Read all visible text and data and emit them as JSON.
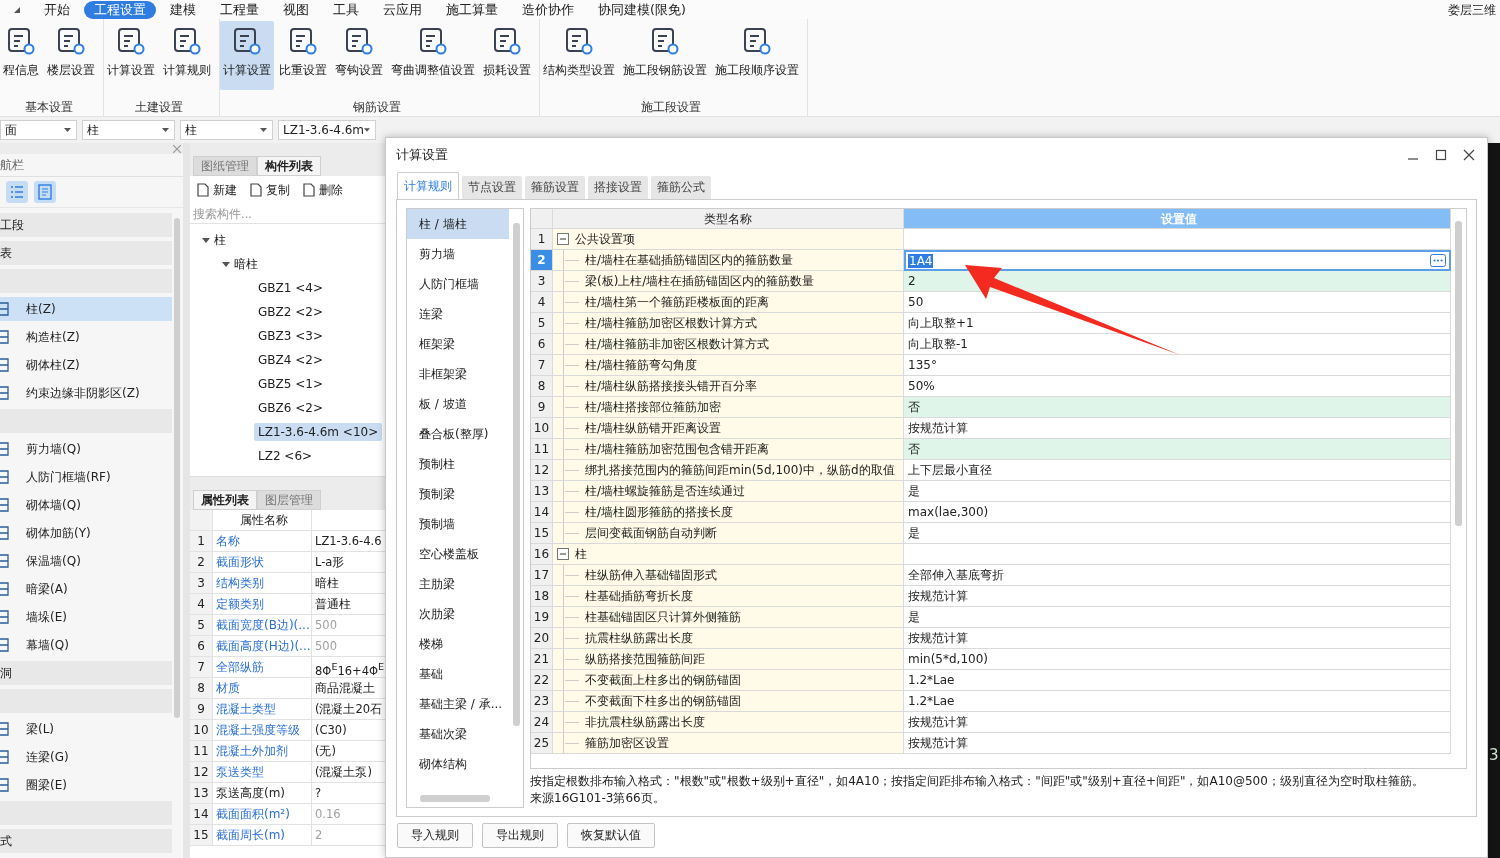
{
  "menu": {
    "tabs": [
      {
        "label": "开始",
        "selected": false
      },
      {
        "label": "工程设置",
        "selected": true
      },
      {
        "label": "建模",
        "selected": false
      },
      {
        "label": "工程量",
        "selected": false
      },
      {
        "label": "视图",
        "selected": false
      },
      {
        "label": "工具",
        "selected": false
      },
      {
        "label": "云应用",
        "selected": false
      },
      {
        "label": "施工算量",
        "selected": false
      },
      {
        "label": "造价协作",
        "selected": false
      },
      {
        "label": "协同建模(限免)",
        "selected": false
      }
    ],
    "right_label": "娄层三维"
  },
  "ribbon": {
    "groups": [
      {
        "label": "基本设置",
        "buttons": [
          {
            "label": "程信息",
            "selected": false
          },
          {
            "label": "楼层设置",
            "selected": false
          }
        ]
      },
      {
        "label": "土建设置",
        "buttons": [
          {
            "label": "计算设置",
            "selected": false
          },
          {
            "label": "计算规则",
            "selected": false
          }
        ]
      },
      {
        "label": "钢筋设置",
        "buttons": [
          {
            "label": "计算设置",
            "selected": true
          },
          {
            "label": "比重设置",
            "selected": false
          },
          {
            "label": "弯钩设置",
            "selected": false
          },
          {
            "label": "弯曲调整值设置",
            "selected": false
          },
          {
            "label": "损耗设置",
            "selected": false
          }
        ]
      },
      {
        "label": "施工段设置",
        "buttons": [
          {
            "label": "结构类型设置",
            "selected": false
          },
          {
            "label": "施工段钢筋设置",
            "selected": false
          },
          {
            "label": "施工段顺序设置",
            "selected": false
          }
        ]
      }
    ]
  },
  "selectors": [
    "面",
    "柱",
    "柱",
    "LZ1-3.6-4.6m"
  ],
  "nav": {
    "title": "航栏",
    "items": [
      {
        "kind": "band",
        "label": "工段"
      },
      {
        "kind": "band",
        "label": "表"
      },
      {
        "kind": "band"
      },
      {
        "kind": "item",
        "label": "柱(Z)",
        "selected": true
      },
      {
        "kind": "item",
        "label": "构造柱(Z)",
        "selected": false
      },
      {
        "kind": "item",
        "label": "砌体柱(Z)",
        "selected": false
      },
      {
        "kind": "item",
        "label": "约束边缘非阴影区(Z)",
        "selected": false
      },
      {
        "kind": "band"
      },
      {
        "kind": "item",
        "label": "剪力墙(Q)",
        "selected": false
      },
      {
        "kind": "item",
        "label": "人防门框墙(RF)",
        "selected": false
      },
      {
        "kind": "item",
        "label": "砌体墙(Q)",
        "selected": false
      },
      {
        "kind": "item",
        "label": "砌体加筋(Y)",
        "selected": false
      },
      {
        "kind": "item",
        "label": "保温墙(Q)",
        "selected": false
      },
      {
        "kind": "item",
        "label": "暗梁(A)",
        "selected": false
      },
      {
        "kind": "item",
        "label": "墙垛(E)",
        "selected": false
      },
      {
        "kind": "item",
        "label": "幕墙(Q)",
        "selected": false
      },
      {
        "kind": "band",
        "label": "洞"
      },
      {
        "kind": "band"
      },
      {
        "kind": "item",
        "label": "梁(L)",
        "selected": false
      },
      {
        "kind": "item",
        "label": "连梁(G)",
        "selected": false
      },
      {
        "kind": "item",
        "label": "圈梁(E)",
        "selected": false
      },
      {
        "kind": "band"
      },
      {
        "kind": "band",
        "label": "式"
      }
    ]
  },
  "components": {
    "tabs": [
      {
        "label": "图纸管理",
        "selected": false
      },
      {
        "label": "构件列表",
        "selected": true
      }
    ],
    "toolbar": [
      "新建",
      "复制",
      "删除"
    ],
    "search": {
      "placeholder": "搜索构件..."
    },
    "tree": [
      {
        "label": "柱",
        "expanded": true,
        "children": [
          {
            "label": "暗柱",
            "expanded": true,
            "children": [
              {
                "label": "GBZ1 <4>",
                "selected": false
              },
              {
                "label": "GBZ2 <2>",
                "selected": false
              },
              {
                "label": "GBZ3 <3>",
                "selected": false
              },
              {
                "label": "GBZ4 <2>",
                "selected": false
              },
              {
                "label": "GBZ5 <1>",
                "selected": false
              },
              {
                "label": "GBZ6 <2>",
                "selected": false
              },
              {
                "label": "LZ1-3.6-4.6m <10>",
                "selected": true
              },
              {
                "label": "LZ2 <6>",
                "selected": false
              }
            ]
          }
        ]
      }
    ]
  },
  "properties": {
    "tabs": [
      {
        "label": "属性列表",
        "selected": true
      },
      {
        "label": "图层管理",
        "selected": false
      }
    ],
    "column": "属性名称",
    "rows": [
      {
        "num": "1",
        "name": "名称",
        "value": "LZ1-3.6-4.6",
        "link": true,
        "greyed": false
      },
      {
        "num": "2",
        "name": "截面形状",
        "value": "L-a形",
        "link": true,
        "greyed": false
      },
      {
        "num": "3",
        "name": "结构类别",
        "value": "暗柱",
        "link": true,
        "greyed": false
      },
      {
        "num": "4",
        "name": "定额类别",
        "value": "普通柱",
        "link": true,
        "greyed": false
      },
      {
        "num": "5",
        "name": "截面宽度(B边)(...",
        "value": "500",
        "link": true,
        "greyed": true
      },
      {
        "num": "6",
        "name": "截面高度(H边)(...",
        "value": "500",
        "link": true,
        "greyed": true
      },
      {
        "num": "7",
        "name": "全部纵筋",
        "value": "8Φ$^{E}$16+4Φ$^{E}$",
        "link": true,
        "greyed": false
      },
      {
        "num": "8",
        "name": "材质",
        "value": "商品混凝土",
        "link": true,
        "greyed": false
      },
      {
        "num": "9",
        "name": "混凝土类型",
        "value": "(混凝土20石",
        "link": true,
        "greyed": false
      },
      {
        "num": "10",
        "name": "混凝土强度等级",
        "value": "(C30)",
        "link": true,
        "greyed": false
      },
      {
        "num": "11",
        "name": "混凝土外加剂",
        "value": "(无)",
        "link": true,
        "greyed": false
      },
      {
        "num": "12",
        "name": "泵送类型",
        "value": "(混凝土泵)",
        "link": true,
        "greyed": false
      },
      {
        "num": "13",
        "name": "泵送高度(m)",
        "value": "?",
        "link": false,
        "greyed": false
      },
      {
        "num": "14",
        "name": "截面面积(m²)",
        "value": "0.16",
        "link": true,
        "greyed": true
      },
      {
        "num": "15",
        "name": "截面周长(m)",
        "value": "2",
        "link": true,
        "greyed": true
      }
    ]
  },
  "dialog": {
    "title": "计算设置",
    "tabs": [
      {
        "label": "计算规则",
        "selected": true
      },
      {
        "label": "节点设置",
        "selected": false
      },
      {
        "label": "箍筋设置",
        "selected": false
      },
      {
        "label": "搭接设置",
        "selected": false
      },
      {
        "label": "箍筋公式",
        "selected": false
      }
    ],
    "categories": [
      {
        "label": "柱 / 墙柱",
        "selected": true
      },
      {
        "label": "剪力墙",
        "selected": false
      },
      {
        "label": "人防门框墙",
        "selected": false
      },
      {
        "label": "连梁",
        "selected": false
      },
      {
        "label": "框架梁",
        "selected": false
      },
      {
        "label": "非框架梁",
        "selected": false
      },
      {
        "label": "板 / 坡道",
        "selected": false
      },
      {
        "label": "叠合板(整厚)",
        "selected": false
      },
      {
        "label": "预制柱",
        "selected": false
      },
      {
        "label": "预制梁",
        "selected": false
      },
      {
        "label": "预制墙",
        "selected": false
      },
      {
        "label": "空心楼盖板",
        "selected": false
      },
      {
        "label": "主肋梁",
        "selected": false
      },
      {
        "label": "次肋梁",
        "selected": false
      },
      {
        "label": "楼梯",
        "selected": false
      },
      {
        "label": "基础",
        "selected": false
      },
      {
        "label": "基础主梁 / 承...",
        "selected": false
      },
      {
        "label": "基础次梁",
        "selected": false
      },
      {
        "label": "砌体结构",
        "selected": false
      }
    ],
    "table": {
      "columns": [
        "类型名称",
        "设置值"
      ],
      "rows": [
        {
          "kind": "group",
          "num": "1",
          "name": "公共设置项",
          "expanded": true
        },
        {
          "kind": "item",
          "num": "2",
          "name": "柱/墙柱在基础插筋锚固区内的箍筋数量",
          "value": "1A4",
          "selected": true,
          "highlighted": false
        },
        {
          "kind": "item",
          "num": "3",
          "name": "梁(板)上柱/墙柱在插筋锚固区内的箍筋数量",
          "value": "2",
          "selected": false,
          "highlighted": true
        },
        {
          "kind": "item",
          "num": "4",
          "name": "柱/墙柱第一个箍筋距楼板面的距离",
          "value": "50",
          "selected": false,
          "highlighted": false
        },
        {
          "kind": "item",
          "num": "5",
          "name": "柱/墙柱箍筋加密区根数计算方式",
          "value": "向上取整+1",
          "selected": false,
          "highlighted": false
        },
        {
          "kind": "item",
          "num": "6",
          "name": "柱/墙柱箍筋非加密区根数计算方式",
          "value": "向上取整-1",
          "selected": false,
          "highlighted": false
        },
        {
          "kind": "item",
          "num": "7",
          "name": "柱/墙柱箍筋弯勾角度",
          "value": "135°",
          "selected": false,
          "highlighted": false
        },
        {
          "kind": "item",
          "num": "8",
          "name": "柱/墙柱纵筋搭接接头错开百分率",
          "value": "50%",
          "selected": false,
          "highlighted": false
        },
        {
          "kind": "item",
          "num": "9",
          "name": "柱/墙柱搭接部位箍筋加密",
          "value": "否",
          "selected": false,
          "highlighted": true
        },
        {
          "kind": "item",
          "num": "10",
          "name": "柱/墙柱纵筋错开距离设置",
          "value": "按规范计算",
          "selected": false,
          "highlighted": false
        },
        {
          "kind": "item",
          "num": "11",
          "name": "柱/墙柱箍筋加密范围包含错开距离",
          "value": "否",
          "selected": false,
          "highlighted": true
        },
        {
          "kind": "item",
          "num": "12",
          "name": "绑扎搭接范围内的箍筋间距min(5d,100)中，纵筋d的取值",
          "value": "上下层最小直径",
          "selected": false,
          "highlighted": false
        },
        {
          "kind": "item",
          "num": "13",
          "name": "柱/墙柱螺旋箍筋是否连续通过",
          "value": "是",
          "selected": false,
          "highlighted": false
        },
        {
          "kind": "item",
          "num": "14",
          "name": "柱/墙柱圆形箍筋的搭接长度",
          "value": "max(lae,300)",
          "selected": false,
          "highlighted": false
        },
        {
          "kind": "item",
          "num": "15",
          "name": "层间变截面钢筋自动判断",
          "value": "是",
          "selected": false,
          "highlighted": false
        },
        {
          "kind": "group",
          "num": "16",
          "name": "柱",
          "expanded": true
        },
        {
          "kind": "item",
          "num": "17",
          "name": "柱纵筋伸入基础锚固形式",
          "value": "全部伸入基底弯折",
          "selected": false,
          "highlighted": false
        },
        {
          "kind": "item",
          "num": "18",
          "name": "柱基础插筋弯折长度",
          "value": "按规范计算",
          "selected": false,
          "highlighted": false
        },
        {
          "kind": "item",
          "num": "19",
          "name": "柱基础锚固区只计算外侧箍筋",
          "value": "是",
          "selected": false,
          "highlighted": false
        },
        {
          "kind": "item",
          "num": "20",
          "name": "抗震柱纵筋露出长度",
          "value": "按规范计算",
          "selected": false,
          "highlighted": false
        },
        {
          "kind": "item",
          "num": "21",
          "name": "纵筋搭接范围箍筋间距",
          "value": "min(5*d,100)",
          "selected": false,
          "highlighted": false
        },
        {
          "kind": "item",
          "num": "22",
          "name": "不变截面上柱多出的钢筋锚固",
          "value": "1.2*Lae",
          "selected": false,
          "highlighted": false
        },
        {
          "kind": "item",
          "num": "23",
          "name": "不变截面下柱多出的钢筋锚固",
          "value": "1.2*Lae",
          "selected": false,
          "highlighted": false
        },
        {
          "kind": "item",
          "num": "24",
          "name": "非抗震柱纵筋露出长度",
          "value": "按规范计算",
          "selected": false,
          "highlighted": false
        },
        {
          "kind": "item",
          "num": "25",
          "name": "箍筋加密区设置",
          "value": "按规范计算",
          "selected": false,
          "highlighted": false
        }
      ]
    },
    "note": "按指定根数排布输入格式：\"根数\"或\"根数+级别+直径\"，如4A10；按指定间距排布输入格式：\"间距\"或\"级别+直径+间距\"，如A10@500；级别直径为空时取柱箍筋。来源16G101-3第66页。",
    "buttons": [
      "导入规则",
      "导出规则",
      "恢复默认值"
    ]
  },
  "canvas": {
    "label": "3"
  }
}
